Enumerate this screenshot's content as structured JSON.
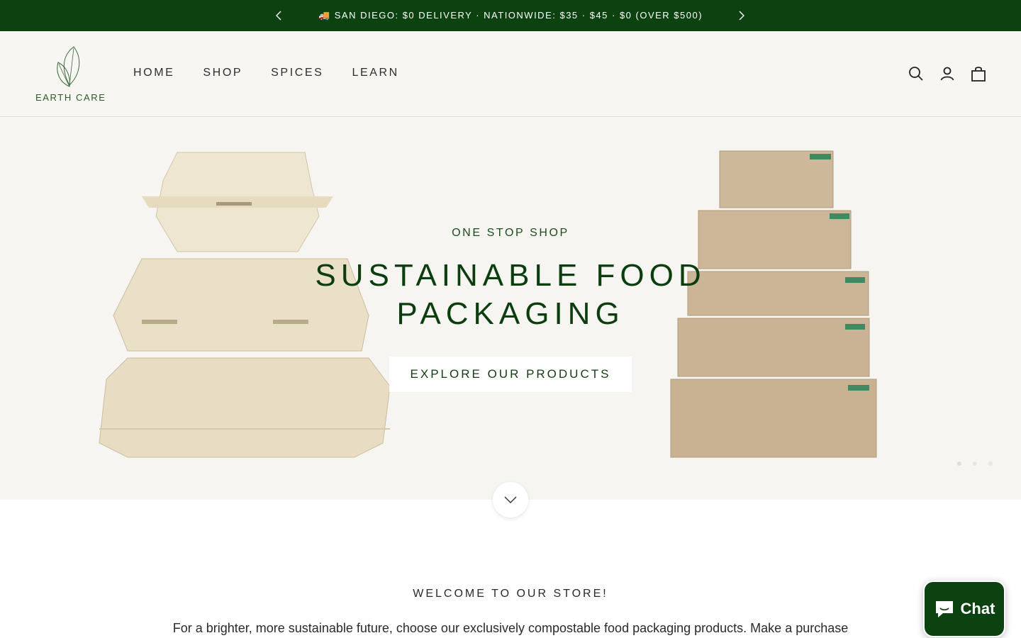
{
  "announcement": {
    "text": "🚚 SAN DIEGO: $0 DELIVERY · NATIONWIDE: $35 · $45 · $0 (OVER $500)",
    "prev_icon": "chevron-left-icon",
    "next_icon": "chevron-right-icon"
  },
  "header": {
    "logo_text": "EARTH CARE",
    "nav": [
      {
        "label": "HOME"
      },
      {
        "label": "SHOP"
      },
      {
        "label": "SPICES"
      },
      {
        "label": "LEARN"
      }
    ],
    "icons": [
      "search-icon",
      "account-icon",
      "cart-icon"
    ]
  },
  "hero": {
    "subtitle": "ONE STOP SHOP",
    "title_line1": "SUSTAINABLE FOOD",
    "title_line2": "PACKAGING",
    "cta_label": "EXPLORE OUR PRODUCTS",
    "slide_count": 3,
    "active_slide": 1
  },
  "welcome": {
    "title": "WELCOME TO OUR STORE!",
    "text": "For a brighter, more sustainable future, choose our exclusively compostable food packaging products. Make a purchase"
  },
  "chat": {
    "label": "Chat"
  },
  "colors": {
    "brand_green": "#0b4210",
    "header_bg": "#f7f6f2",
    "hero_bg": "#f6f5f1"
  }
}
